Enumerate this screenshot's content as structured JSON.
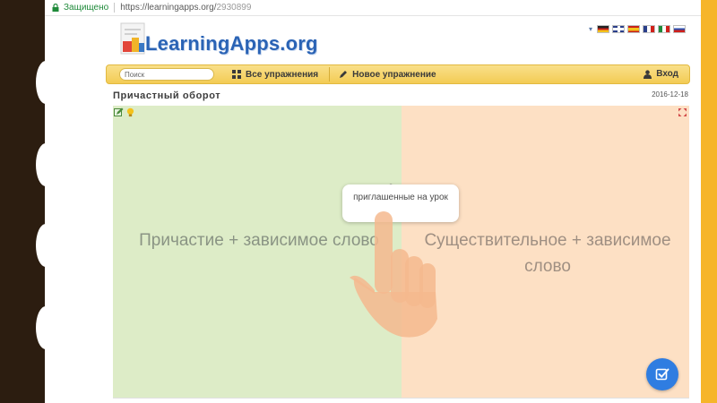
{
  "browser": {
    "secure_label": "Защищено",
    "url_host": "https://learningapps.org/",
    "url_path": "2930899"
  },
  "site": {
    "logo_text": "LearningApps.org",
    "languages": [
      "de",
      "en",
      "es",
      "fr",
      "it",
      "ru"
    ]
  },
  "nav": {
    "search_placeholder": "Поиск",
    "all_exercises": "Все упражнения",
    "new_exercise": "Новое упражнение",
    "login": "Вход"
  },
  "exercise": {
    "title": "Причастный оборот",
    "date": "2016-12-18",
    "left_category": "Причастие + зависимое слово",
    "right_category": "Существительное + зависимое слово",
    "card_hint": "?",
    "card_text": "приглашенные на урок"
  },
  "colors": {
    "left_panel": "#ddecc7",
    "right_panel": "#fde0c4",
    "nav_bar": "#f3cc54",
    "logo": "#2a63b5",
    "check_button": "#2f7de1"
  }
}
